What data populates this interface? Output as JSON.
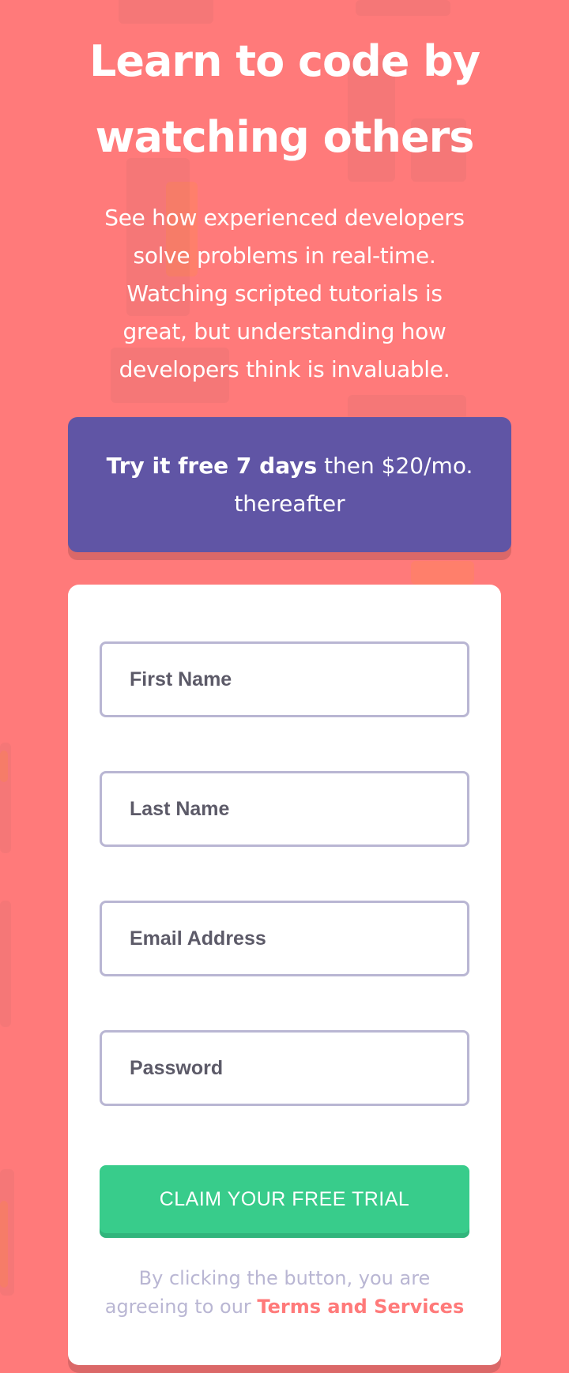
{
  "hero": {
    "title_line1": "Learn to code by",
    "title_line2": "watching others",
    "lead_lines": [
      "See how experienced developers",
      "solve problems in real-time.",
      "Watching scripted tutorials is",
      "great, but understanding how",
      "developers think is invaluable."
    ]
  },
  "promo": {
    "bold": "Try it free 7 days",
    "rest": "then $20/mo.",
    "line2": "thereafter"
  },
  "form": {
    "first_name_placeholder": "First Name",
    "last_name_placeholder": "Last Name",
    "email_placeholder": "Email Address",
    "password_placeholder": "Password",
    "submit_label": "CLAIM YOUR FREE TRIAL",
    "terms_line1": "By clicking the button, you are",
    "terms_line2_prefix": "agreeing to our",
    "terms_link": "Terms and Services"
  },
  "colors": {
    "background": "#ff7a7a",
    "promo": "#6055a5",
    "cta": "#38cc8b",
    "field_border": "#b9b6d3"
  }
}
